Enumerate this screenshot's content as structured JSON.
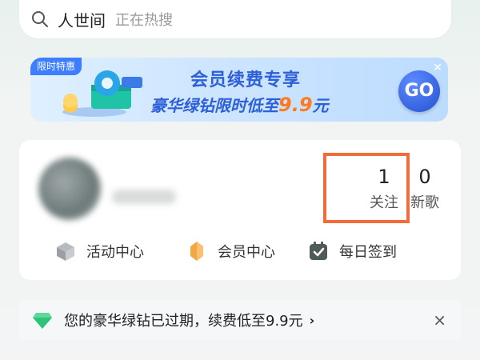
{
  "search": {
    "term": "人世间",
    "hint": "正在热搜",
    "icon": "search-icon"
  },
  "banner": {
    "tag": "限时特惠",
    "title": "会员续费专享",
    "subtitle_prefix": "豪华绿钻限时低至",
    "subtitle_price": "9.9",
    "subtitle_suffix": "元",
    "go_label": "GO",
    "close_icon": "close-icon",
    "accent_color": "#2d5fd8",
    "price_color": "#ff7a1f"
  },
  "profile": {
    "stats": [
      {
        "value": "1",
        "label": "关注"
      },
      {
        "value": "0",
        "label": "新歌"
      }
    ],
    "highlight_color": "#f26b3a"
  },
  "shortcuts": [
    {
      "label": "活动中心",
      "icon": "cube-icon"
    },
    {
      "label": "会员中心",
      "icon": "vip-shield-icon"
    },
    {
      "label": "每日签到",
      "icon": "calendar-check-icon"
    }
  ],
  "notice": {
    "message": "您的豪华绿钻已过期，续费低至9.9元",
    "chevron": "›",
    "close": "×",
    "icon": "green-diamond-icon"
  }
}
